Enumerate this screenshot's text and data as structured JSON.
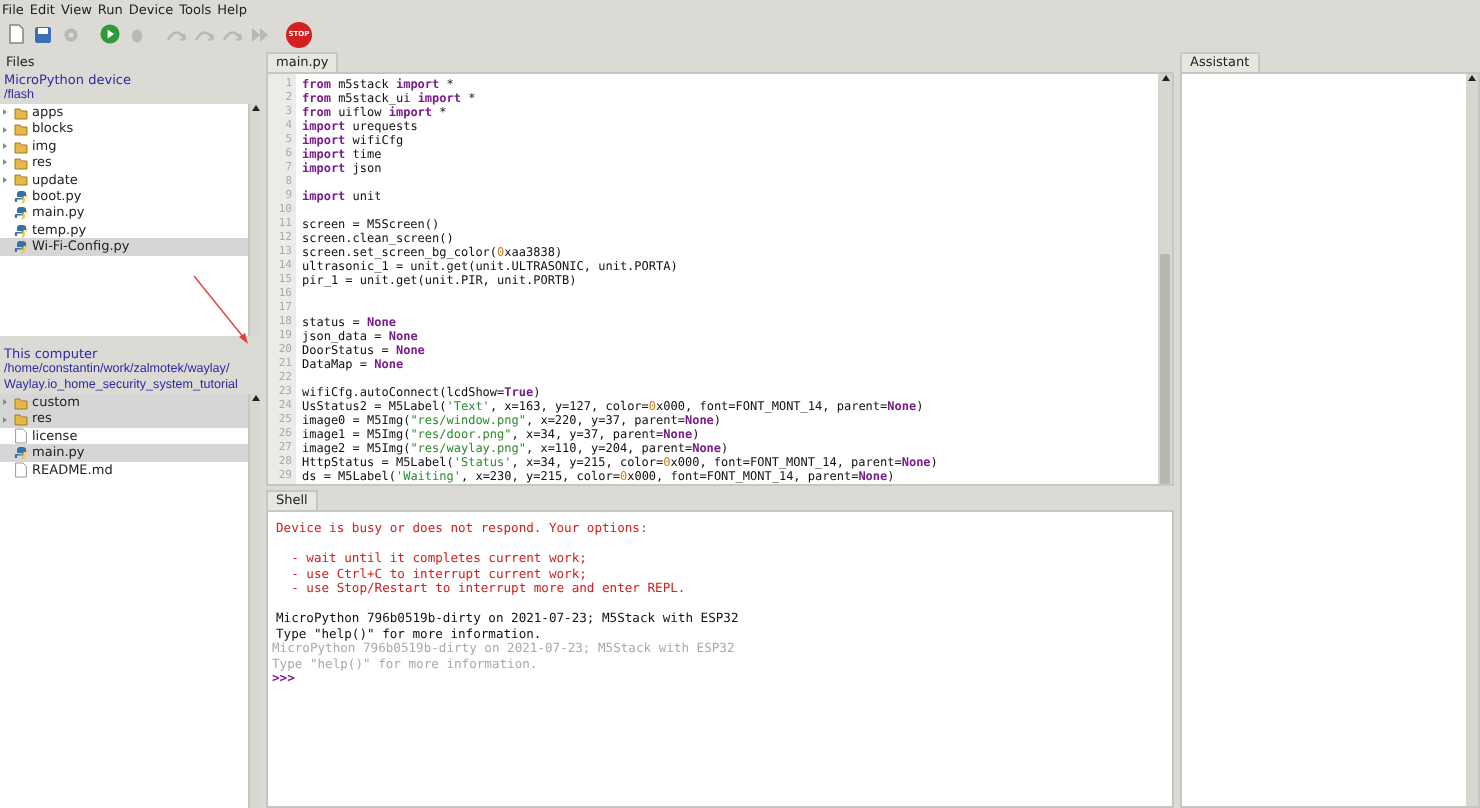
{
  "menu": [
    "File",
    "Edit",
    "View",
    "Run",
    "Device",
    "Tools",
    "Help"
  ],
  "toolbar": [
    {
      "kind": "new",
      "disabled": false
    },
    {
      "kind": "save",
      "disabled": false
    },
    {
      "kind": "gear",
      "disabled": true
    },
    {
      "kind": "run",
      "disabled": false
    },
    {
      "kind": "debug",
      "disabled": true
    },
    {
      "kind": "step",
      "disabled": true
    },
    {
      "kind": "step",
      "disabled": true
    },
    {
      "kind": "step",
      "disabled": true
    },
    {
      "kind": "resume",
      "disabled": true
    },
    {
      "kind": "stop",
      "disabled": false,
      "label": "STOP"
    }
  ],
  "files": {
    "title": "Files",
    "device": {
      "title": "MicroPython device",
      "path": "/flash",
      "items": [
        {
          "name": "apps",
          "kind": "folder",
          "selected": false
        },
        {
          "name": "blocks",
          "kind": "folder",
          "selected": false
        },
        {
          "name": "img",
          "kind": "folder",
          "selected": false
        },
        {
          "name": "res",
          "kind": "folder",
          "selected": false
        },
        {
          "name": "update",
          "kind": "folder",
          "selected": false
        },
        {
          "name": "boot.py",
          "kind": "python",
          "selected": false
        },
        {
          "name": "main.py",
          "kind": "python",
          "selected": false
        },
        {
          "name": "temp.py",
          "kind": "python",
          "selected": false
        },
        {
          "name": "Wi-Fi-Config.py",
          "kind": "python",
          "selected": true
        }
      ]
    },
    "computer": {
      "title": "This computer",
      "path": "/home/constantin/work/zalmotek/waylay/ Waylay.io_home_security_system_tutorial",
      "items": [
        {
          "name": "custom",
          "kind": "folder",
          "selected": true
        },
        {
          "name": "res",
          "kind": "folder",
          "selected": true
        },
        {
          "name": "license",
          "kind": "file",
          "selected": false
        },
        {
          "name": "main.py",
          "kind": "python",
          "selected": true
        },
        {
          "name": "README.md",
          "kind": "file",
          "selected": false
        }
      ]
    }
  },
  "editor": {
    "tab": "main.py",
    "lines": [
      {
        "number": "1",
        "tokens": [
          {
            "text": "from",
            "kind": "keyword"
          },
          {
            "text": " m5stack ",
            "kind": "plain"
          },
          {
            "text": "import",
            "kind": "keyword"
          },
          {
            "text": " *",
            "kind": "plain"
          }
        ]
      },
      {
        "number": "2",
        "tokens": [
          {
            "text": "from",
            "kind": "keyword"
          },
          {
            "text": " m5stack_ui ",
            "kind": "plain"
          },
          {
            "text": "import",
            "kind": "keyword"
          },
          {
            "text": " *",
            "kind": "plain"
          }
        ]
      },
      {
        "number": "3",
        "tokens": [
          {
            "text": "from",
            "kind": "keyword"
          },
          {
            "text": " uiflow ",
            "kind": "plain"
          },
          {
            "text": "import",
            "kind": "keyword"
          },
          {
            "text": " *",
            "kind": "plain"
          }
        ]
      },
      {
        "number": "4",
        "tokens": [
          {
            "text": "import",
            "kind": "keyword"
          },
          {
            "text": " urequests",
            "kind": "plain"
          }
        ]
      },
      {
        "number": "5",
        "tokens": [
          {
            "text": "import",
            "kind": "keyword"
          },
          {
            "text": " wifiCfg",
            "kind": "plain"
          }
        ]
      },
      {
        "number": "6",
        "tokens": [
          {
            "text": "import",
            "kind": "keyword"
          },
          {
            "text": " time",
            "kind": "plain"
          }
        ]
      },
      {
        "number": "7",
        "tokens": [
          {
            "text": "import",
            "kind": "keyword"
          },
          {
            "text": " json",
            "kind": "plain"
          }
        ]
      },
      {
        "number": "8"
      },
      {
        "number": "9",
        "tokens": [
          {
            "text": "import",
            "kind": "keyword"
          },
          {
            "text": " unit",
            "kind": "plain"
          }
        ]
      },
      {
        "number": "10"
      },
      {
        "number": "11",
        "tokens": [
          {
            "text": "screen = M5Screen()",
            "kind": "plain"
          }
        ]
      },
      {
        "number": "12",
        "tokens": [
          {
            "text": "screen.clean_screen()",
            "kind": "plain"
          }
        ]
      },
      {
        "number": "13",
        "tokens": [
          {
            "text": "screen.set_screen_bg_color(",
            "kind": "plain"
          },
          {
            "text": "0",
            "kind": "number"
          },
          {
            "text": "xaa3838)",
            "kind": "plain"
          }
        ]
      },
      {
        "number": "14",
        "tokens": [
          {
            "text": "ultrasonic_1 = unit.get(unit.ULTRASONIC, unit.PORTA)",
            "kind": "plain"
          }
        ]
      },
      {
        "number": "15",
        "tokens": [
          {
            "text": "pir_1 = unit.get(unit.PIR, unit.PORTB)",
            "kind": "plain"
          }
        ]
      },
      {
        "number": "16"
      },
      {
        "number": "17"
      },
      {
        "number": "18",
        "tokens": [
          {
            "text": "status = ",
            "kind": "plain"
          },
          {
            "text": "None",
            "kind": "keyword"
          }
        ]
      },
      {
        "number": "19",
        "tokens": [
          {
            "text": "json_data = ",
            "kind": "plain"
          },
          {
            "text": "None",
            "kind": "keyword"
          }
        ]
      },
      {
        "number": "20",
        "tokens": [
          {
            "text": "DoorStatus = ",
            "kind": "plain"
          },
          {
            "text": "None",
            "kind": "keyword"
          }
        ]
      },
      {
        "number": "21",
        "tokens": [
          {
            "text": "DataMap = ",
            "kind": "plain"
          },
          {
            "text": "None",
            "kind": "keyword"
          }
        ]
      },
      {
        "number": "22"
      },
      {
        "number": "23",
        "tokens": [
          {
            "text": "wifiCfg.autoConnect(lcdShow=",
            "kind": "plain"
          },
          {
            "text": "True",
            "kind": "keyword"
          },
          {
            "text": ")",
            "kind": "plain"
          }
        ]
      },
      {
        "number": "24",
        "tokens": [
          {
            "text": "UsStatus2 = M5Label(",
            "kind": "plain"
          },
          {
            "text": "'Text'",
            "kind": "string"
          },
          {
            "text": ", x=163, y=127, color=",
            "kind": "plain"
          },
          {
            "text": "0",
            "kind": "number"
          },
          {
            "text": "x000, font=FONT_MONT_14, parent=",
            "kind": "plain"
          },
          {
            "text": "None",
            "kind": "keyword"
          },
          {
            "text": ")",
            "kind": "plain"
          }
        ]
      },
      {
        "number": "25",
        "tokens": [
          {
            "text": "image0 = M5Img(",
            "kind": "plain"
          },
          {
            "text": "\"res/window.png\"",
            "kind": "string"
          },
          {
            "text": ", x=220, y=37, parent=",
            "kind": "plain"
          },
          {
            "text": "None",
            "kind": "keyword"
          },
          {
            "text": ")",
            "kind": "plain"
          }
        ]
      },
      {
        "number": "26",
        "tokens": [
          {
            "text": "image1 = M5Img(",
            "kind": "plain"
          },
          {
            "text": "\"res/door.png\"",
            "kind": "string"
          },
          {
            "text": ", x=34, y=37, parent=",
            "kind": "plain"
          },
          {
            "text": "None",
            "kind": "keyword"
          },
          {
            "text": ")",
            "kind": "plain"
          }
        ]
      },
      {
        "number": "27",
        "tokens": [
          {
            "text": "image2 = M5Img(",
            "kind": "plain"
          },
          {
            "text": "\"res/waylay.png\"",
            "kind": "string"
          },
          {
            "text": ", x=110, y=204, parent=",
            "kind": "plain"
          },
          {
            "text": "None",
            "kind": "keyword"
          },
          {
            "text": ")",
            "kind": "plain"
          }
        ]
      },
      {
        "number": "28",
        "tokens": [
          {
            "text": "HttpStatus = M5Label(",
            "kind": "plain"
          },
          {
            "text": "'Status'",
            "kind": "string"
          },
          {
            "text": ", x=34, y=215, color=",
            "kind": "plain"
          },
          {
            "text": "0",
            "kind": "number"
          },
          {
            "text": "x000, font=FONT_MONT_14, parent=",
            "kind": "plain"
          },
          {
            "text": "None",
            "kind": "keyword"
          },
          {
            "text": ")",
            "kind": "plain"
          }
        ]
      },
      {
        "number": "29",
        "tokens": [
          {
            "text": "ds = M5Label(",
            "kind": "plain"
          },
          {
            "text": "'Waiting'",
            "kind": "string"
          },
          {
            "text": ", x=230, y=215, color=",
            "kind": "plain"
          },
          {
            "text": "0",
            "kind": "number"
          },
          {
            "text": "x000, font=FONT_MONT_14, parent=",
            "kind": "plain"
          },
          {
            "text": "None",
            "kind": "keyword"
          },
          {
            "text": ")",
            "kind": "plain"
          }
        ]
      }
    ]
  },
  "shell": {
    "tab": "Shell",
    "lines": [
      {
        "text": "Device is busy or does not respond. Your options:",
        "kind": "error"
      },
      {
        "kind": "blank"
      },
      {
        "text": "  - wait until it completes current work;",
        "kind": "error"
      },
      {
        "text": "  - use Ctrl+C to interrupt current work;",
        "kind": "error"
      },
      {
        "text": "  - use Stop/Restart to interrupt more and enter REPL.",
        "kind": "error"
      },
      {
        "kind": "blank"
      },
      {
        "text": "MicroPython 796b0519b-dirty on 2021-07-23; M5Stack with ESP32",
        "kind": "output"
      },
      {
        "text": "Type \"help()\" for more information.",
        "kind": "output"
      },
      {
        "text": "MicroPython 796b0519b-dirty on 2021-07-23; M5Stack with ESP32",
        "kind": "echo"
      },
      {
        "text": "Type \"help()\" for more information.",
        "kind": "echo"
      },
      {
        "text": ">>>",
        "kind": "prompt"
      }
    ]
  },
  "assistant": {
    "tab": "Assistant"
  }
}
